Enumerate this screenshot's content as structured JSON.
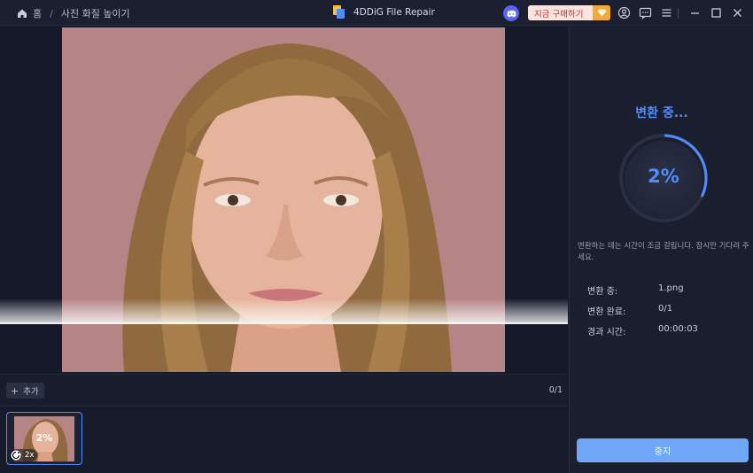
{
  "breadcrumb": {
    "home": "홈",
    "current": "사진 화질 높이기"
  },
  "app": {
    "title": "4DDiG File Repair"
  },
  "topbar": {
    "buy_label": "지금 구매하기"
  },
  "toolbar": {
    "add_label": "추가",
    "count": "0/1"
  },
  "thumbnail": {
    "progress_text": "2%",
    "scale": "2x"
  },
  "side": {
    "status_title": "변환 중...",
    "progress": 0.02,
    "progress_text": "2%",
    "note": "변환하는 데는 시간이 조금 걸립니다. 잠시만 기다려 주세요.",
    "rows": [
      {
        "key": "변환 중:",
        "value": "1.png"
      },
      {
        "key": "변환 완료:",
        "value": "0/1"
      },
      {
        "key": "경과 시간:",
        "value": "00:00:03"
      }
    ],
    "stop_label": "중지"
  },
  "colors": {
    "accent": "#4f8dfc",
    "buy_text": "#c2322f",
    "stop_button": "#6fa8f8"
  }
}
